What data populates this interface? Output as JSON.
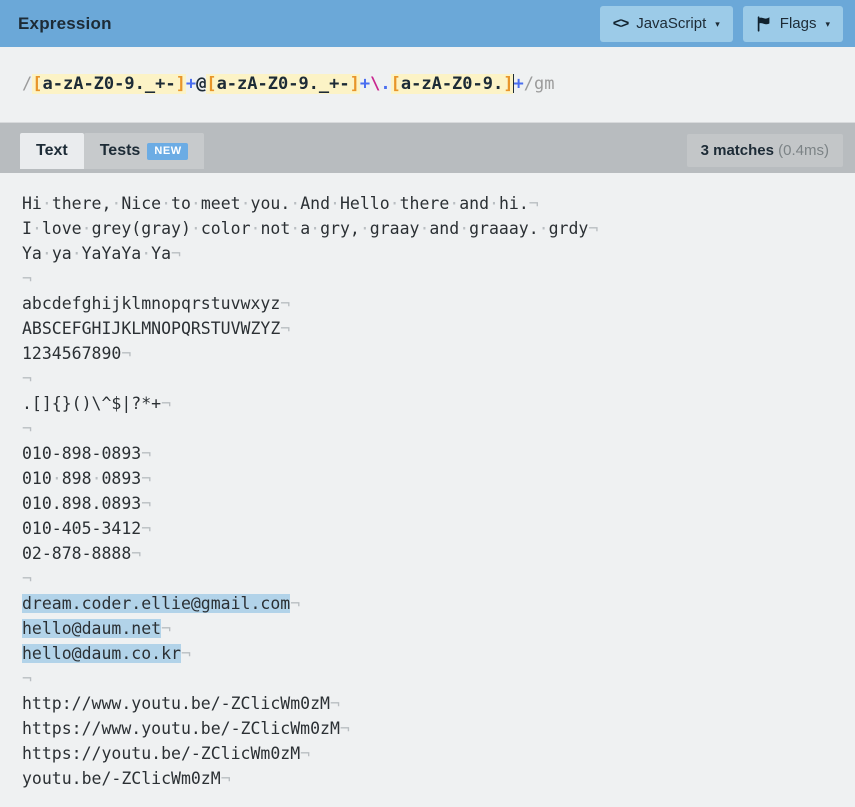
{
  "header": {
    "title": "Expression",
    "language_button": {
      "label": "JavaScript",
      "icon": "code-icon",
      "caret": "▾"
    },
    "flags_button": {
      "label": "Flags",
      "icon": "flag-icon",
      "caret": "▾"
    },
    "bg_color": "#6ba8d8",
    "button_bg_color": "#9ccbe8"
  },
  "expression": {
    "open_delimiter": "/",
    "close_delimiter": "/",
    "flags": "gm",
    "full_pattern": "/[a-zA-Z0-9._+-]+@[a-zA-Z0-9._+-]+\\.[a-zA-Z0-9.]+/gm",
    "tokens": [
      {
        "text": "/",
        "kind": "delim"
      },
      {
        "text": "[",
        "kind": "bracket"
      },
      {
        "text": "a-zA-Z0-9._+-",
        "kind": "setbody"
      },
      {
        "text": "]",
        "kind": "bracket"
      },
      {
        "text": "+",
        "kind": "quant"
      },
      {
        "text": "@",
        "kind": "literal"
      },
      {
        "text": "[",
        "kind": "bracket"
      },
      {
        "text": "a-zA-Z0-9._+-",
        "kind": "setbody"
      },
      {
        "text": "]",
        "kind": "bracket"
      },
      {
        "text": "+",
        "kind": "quant"
      },
      {
        "text": "\\",
        "kind": "escape"
      },
      {
        "text": ".",
        "kind": "escchar"
      },
      {
        "text": "[",
        "kind": "bracket"
      },
      {
        "text": "a-zA-Z0-9.",
        "kind": "setbody"
      },
      {
        "text": "]",
        "kind": "bracket"
      },
      {
        "text": "+",
        "kind": "quant"
      },
      {
        "text": "/",
        "kind": "delim"
      },
      {
        "text": "gm",
        "kind": "flags"
      }
    ],
    "set_highlight_color": "#fcf3c6",
    "bracket_color": "#e8952a",
    "quantifier_color": "#4a6ef0",
    "escape_color": "#c9268f"
  },
  "tabs": {
    "items": [
      {
        "label": "Text",
        "active": true,
        "badge": null
      },
      {
        "label": "Tests",
        "active": false,
        "badge": "NEW"
      }
    ],
    "badge_color": "#6cace4"
  },
  "matches": {
    "count_label": "3 matches",
    "time_label": "(0.4ms)"
  },
  "text_pane": {
    "space_glyph": "·",
    "newline_glyph": "¬",
    "match_highlight_color": "#b2d3e9",
    "lines": [
      {
        "segments": [
          {
            "t": "Hi there, Nice to meet you. And Hello there and hi.",
            "m": false
          }
        ],
        "nl": true
      },
      {
        "segments": [
          {
            "t": "I love grey(gray) color not a gry, graay and graaay. grdy",
            "m": false
          }
        ],
        "nl": true
      },
      {
        "segments": [
          {
            "t": "Ya ya YaYaYa Ya",
            "m": false
          }
        ],
        "nl": true
      },
      {
        "segments": [],
        "nl": true
      },
      {
        "segments": [
          {
            "t": "abcdefghijklmnopqrstuvwxyz",
            "m": false
          }
        ],
        "nl": true
      },
      {
        "segments": [
          {
            "t": "ABSCEFGHIJKLMNOPQRSTUVWZYZ",
            "m": false
          }
        ],
        "nl": true
      },
      {
        "segments": [
          {
            "t": "1234567890",
            "m": false
          }
        ],
        "nl": true
      },
      {
        "segments": [],
        "nl": true
      },
      {
        "segments": [
          {
            "t": ".[]{}()\\^$|?*+",
            "m": false
          }
        ],
        "nl": true
      },
      {
        "segments": [],
        "nl": true
      },
      {
        "segments": [
          {
            "t": "010-898-0893",
            "m": false
          }
        ],
        "nl": true
      },
      {
        "segments": [
          {
            "t": "010 898 0893",
            "m": false
          }
        ],
        "nl": true
      },
      {
        "segments": [
          {
            "t": "010.898.0893",
            "m": false
          }
        ],
        "nl": true
      },
      {
        "segments": [
          {
            "t": "010-405-3412",
            "m": false
          }
        ],
        "nl": true
      },
      {
        "segments": [
          {
            "t": "02-878-8888",
            "m": false
          }
        ],
        "nl": true
      },
      {
        "segments": [],
        "nl": true
      },
      {
        "segments": [
          {
            "t": "dream.coder.ellie@gmail.com",
            "m": true
          }
        ],
        "nl": true
      },
      {
        "segments": [
          {
            "t": "hello@daum.net",
            "m": true
          }
        ],
        "nl": true
      },
      {
        "segments": [
          {
            "t": "hello@daum.co.kr",
            "m": true
          }
        ],
        "nl": true
      },
      {
        "segments": [],
        "nl": true
      },
      {
        "segments": [
          {
            "t": "http://www.youtu.be/-ZClicWm0zM",
            "m": false
          }
        ],
        "nl": true
      },
      {
        "segments": [
          {
            "t": "https://www.youtu.be/-ZClicWm0zM",
            "m": false
          }
        ],
        "nl": true
      },
      {
        "segments": [
          {
            "t": "https://youtu.be/-ZClicWm0zM",
            "m": false
          }
        ],
        "nl": true
      },
      {
        "segments": [
          {
            "t": "youtu.be/-ZClicWm0zM",
            "m": false
          }
        ],
        "nl": true
      }
    ]
  }
}
